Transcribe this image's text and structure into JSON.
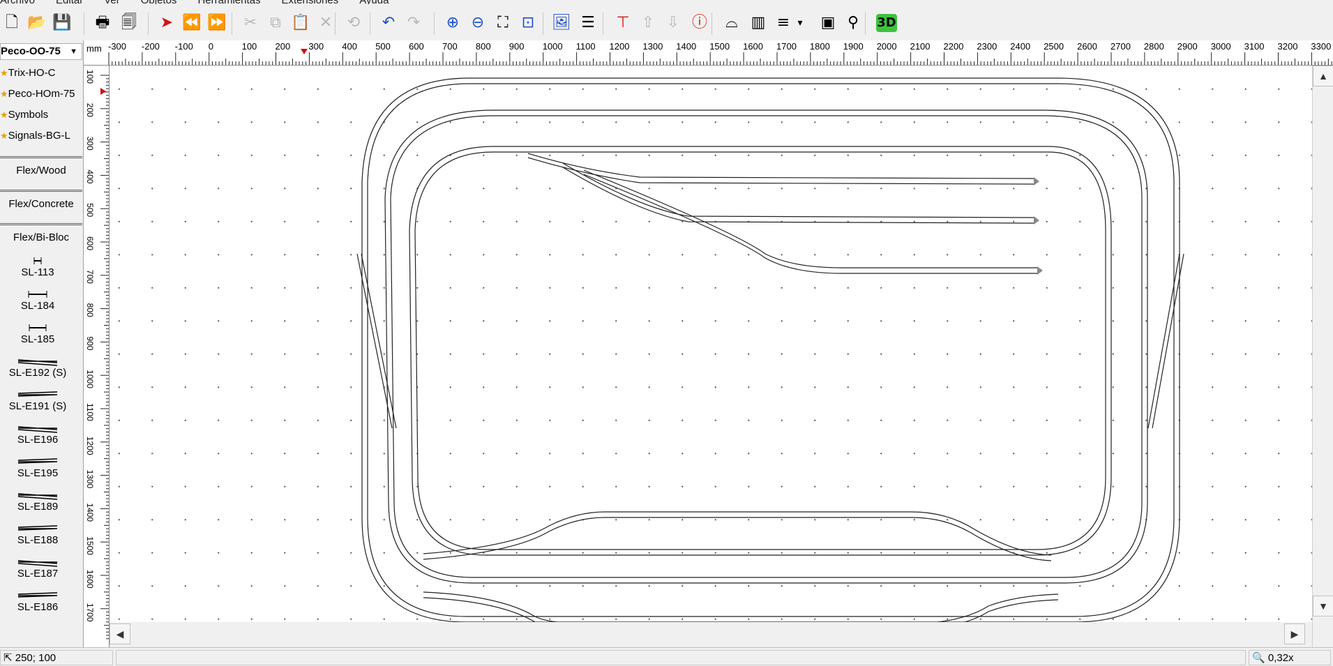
{
  "menu": [
    "Archivo",
    "Editar",
    "Ver",
    "Objetos",
    "Herramientas",
    "Extensiones",
    "Ayuda"
  ],
  "toolbar": {
    "tools": [
      {
        "name": "new-file-icon",
        "glyph": "🗋",
        "style": ""
      },
      {
        "name": "open-folder-icon",
        "glyph": "📂",
        "style": ""
      },
      {
        "name": "save-icon",
        "glyph": "💾",
        "style": ""
      },
      {
        "name": "print-icon",
        "glyph": "🖶",
        "style": ""
      },
      {
        "name": "print-preview-icon",
        "glyph": "🗐",
        "style": ""
      },
      {
        "name": "describe-icon",
        "glyph": "➤",
        "style": "red"
      },
      {
        "name": "rewind-icon",
        "glyph": "⏪",
        "style": "red"
      },
      {
        "name": "forward-icon",
        "glyph": "⏩",
        "style": "red"
      },
      {
        "name": "cut-icon",
        "glyph": "✂",
        "style": "dis"
      },
      {
        "name": "copy-icon",
        "glyph": "⧉",
        "style": "dis"
      },
      {
        "name": "paste-icon",
        "glyph": "📋",
        "style": "dis"
      },
      {
        "name": "delete-icon",
        "glyph": "✕",
        "style": "dis"
      },
      {
        "name": "rotate-icon",
        "glyph": "⟲",
        "style": "dis"
      },
      {
        "name": "undo-icon",
        "glyph": "↶",
        "style": "blue"
      },
      {
        "name": "redo-icon",
        "glyph": "↷",
        "style": "dis"
      },
      {
        "name": "zoom-in-icon",
        "glyph": "⊕",
        "style": "blue"
      },
      {
        "name": "zoom-out-icon",
        "glyph": "⊖",
        "style": "blue"
      },
      {
        "name": "zoom-fit-icon",
        "glyph": "⛶",
        "style": ""
      },
      {
        "name": "zoom-actual-icon",
        "glyph": "⊡",
        "style": "blue"
      },
      {
        "name": "background-image-icon",
        "glyph": "🖼",
        "style": "blue"
      },
      {
        "name": "layers-icon",
        "glyph": "☰",
        "style": ""
      },
      {
        "name": "track-join-icon",
        "glyph": "⊤",
        "style": "red"
      },
      {
        "name": "height-up-icon",
        "glyph": "⇧",
        "style": "dis"
      },
      {
        "name": "height-down-icon",
        "glyph": "⇩",
        "style": "dis"
      },
      {
        "name": "info-icon",
        "glyph": "ⓘ",
        "style": "red"
      },
      {
        "name": "bridge-icon",
        "glyph": "⌓",
        "style": ""
      },
      {
        "name": "tunnel-icon",
        "glyph": "▥",
        "style": ""
      },
      {
        "name": "align-icon",
        "glyph": "≡",
        "style": ""
      },
      {
        "name": "dropdown-caret-icon",
        "glyph": "▾",
        "style": ""
      },
      {
        "name": "parts-list-icon",
        "glyph": "▣",
        "style": ""
      },
      {
        "name": "measure-icon",
        "glyph": "⚲",
        "style": ""
      },
      {
        "name": "view-3d-icon",
        "glyph": "3D",
        "style": "3d"
      }
    ]
  },
  "panel": {
    "library": "Peco-OO-75",
    "favorites": [
      "Trix-HO-C",
      "Peco-HOm-75",
      "Symbols",
      "Signals-BG-L"
    ],
    "groups": [
      "Flex/Wood",
      "Flex/Concrete",
      "Flex/Bi-Bloc"
    ],
    "parts": [
      "SL-113",
      "SL-184",
      "SL-185",
      "SL-E192 (S)",
      "SL-E191 (S)",
      "SL-E196",
      "SL-E195",
      "SL-E189",
      "SL-E188",
      "SL-E187",
      "SL-E186"
    ]
  },
  "ruler": {
    "unit": "mm",
    "h_ticks": [
      "-300",
      "-200",
      "-100",
      "0",
      "100",
      "200",
      "300",
      "400",
      "500",
      "600",
      "700",
      "800",
      "900",
      "1000",
      "1100",
      "1200",
      "1300",
      "1400",
      "1500",
      "1600",
      "1700",
      "1800",
      "1900",
      "2000",
      "2100",
      "2200",
      "2300",
      "2400",
      "2500",
      "2600",
      "2700",
      "2800",
      "2900",
      "3000",
      "3100",
      "3200",
      "3300"
    ],
    "v_ticks": [
      "100",
      "200",
      "300",
      "400",
      "500",
      "600",
      "700",
      "800",
      "900",
      "1000",
      "1100",
      "1200",
      "1300",
      "1400",
      "1500",
      "1600",
      "1700"
    ]
  },
  "status": {
    "coords": "250; 100",
    "zoom": "0,32x"
  }
}
